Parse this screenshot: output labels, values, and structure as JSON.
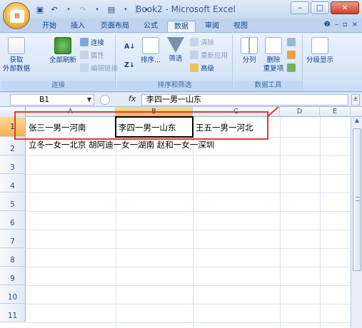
{
  "window": {
    "title": "Book2 - Microsoft Excel",
    "office_logo": "Office",
    "min": "–",
    "max": "□",
    "close": "×"
  },
  "tabs": [
    "开始",
    "插入",
    "页面布局",
    "公式",
    "数据",
    "审阅",
    "视图"
  ],
  "active_tab": "数据",
  "ribbon": {
    "connections": {
      "label": "连接",
      "get_external": "获取\n外部数据",
      "refresh_all": "全部刷新",
      "connections": "连接",
      "properties": "属性",
      "edit_links": "编辑链接"
    },
    "sort_filter": {
      "label": "排序和筛选",
      "sort": "排序...",
      "filter": "筛选",
      "clear": "清除",
      "reapply": "重新应用",
      "advanced": "高级"
    },
    "data_tools": {
      "label": "数据工具",
      "text_to_columns": "分列",
      "remove_dupes": "删除\n重复项"
    },
    "outline": {
      "label": "分级显示"
    }
  },
  "formula_bar": {
    "name_box": "B1",
    "fx": "fx",
    "content": "李四一男一山东"
  },
  "columns": [
    "A",
    "B",
    "C",
    "D",
    "E"
  ],
  "selected_column": "B",
  "rows": [
    "1",
    "2",
    "3",
    "4",
    "5",
    "6",
    "7",
    "8",
    "9",
    "10",
    "11"
  ],
  "selected_row": "1",
  "cells": {
    "A1": "张三一男一河南",
    "B1": "李四一男一山东",
    "C1": "王五一男一河北",
    "A2": "立冬一女一北京  胡阿迪一女一湖南  赵和一女一深圳"
  },
  "colors": {
    "accent_red": "#e03a3a",
    "ribbon_bg": "#dbe8f8",
    "header_select": "#f3b24b"
  }
}
